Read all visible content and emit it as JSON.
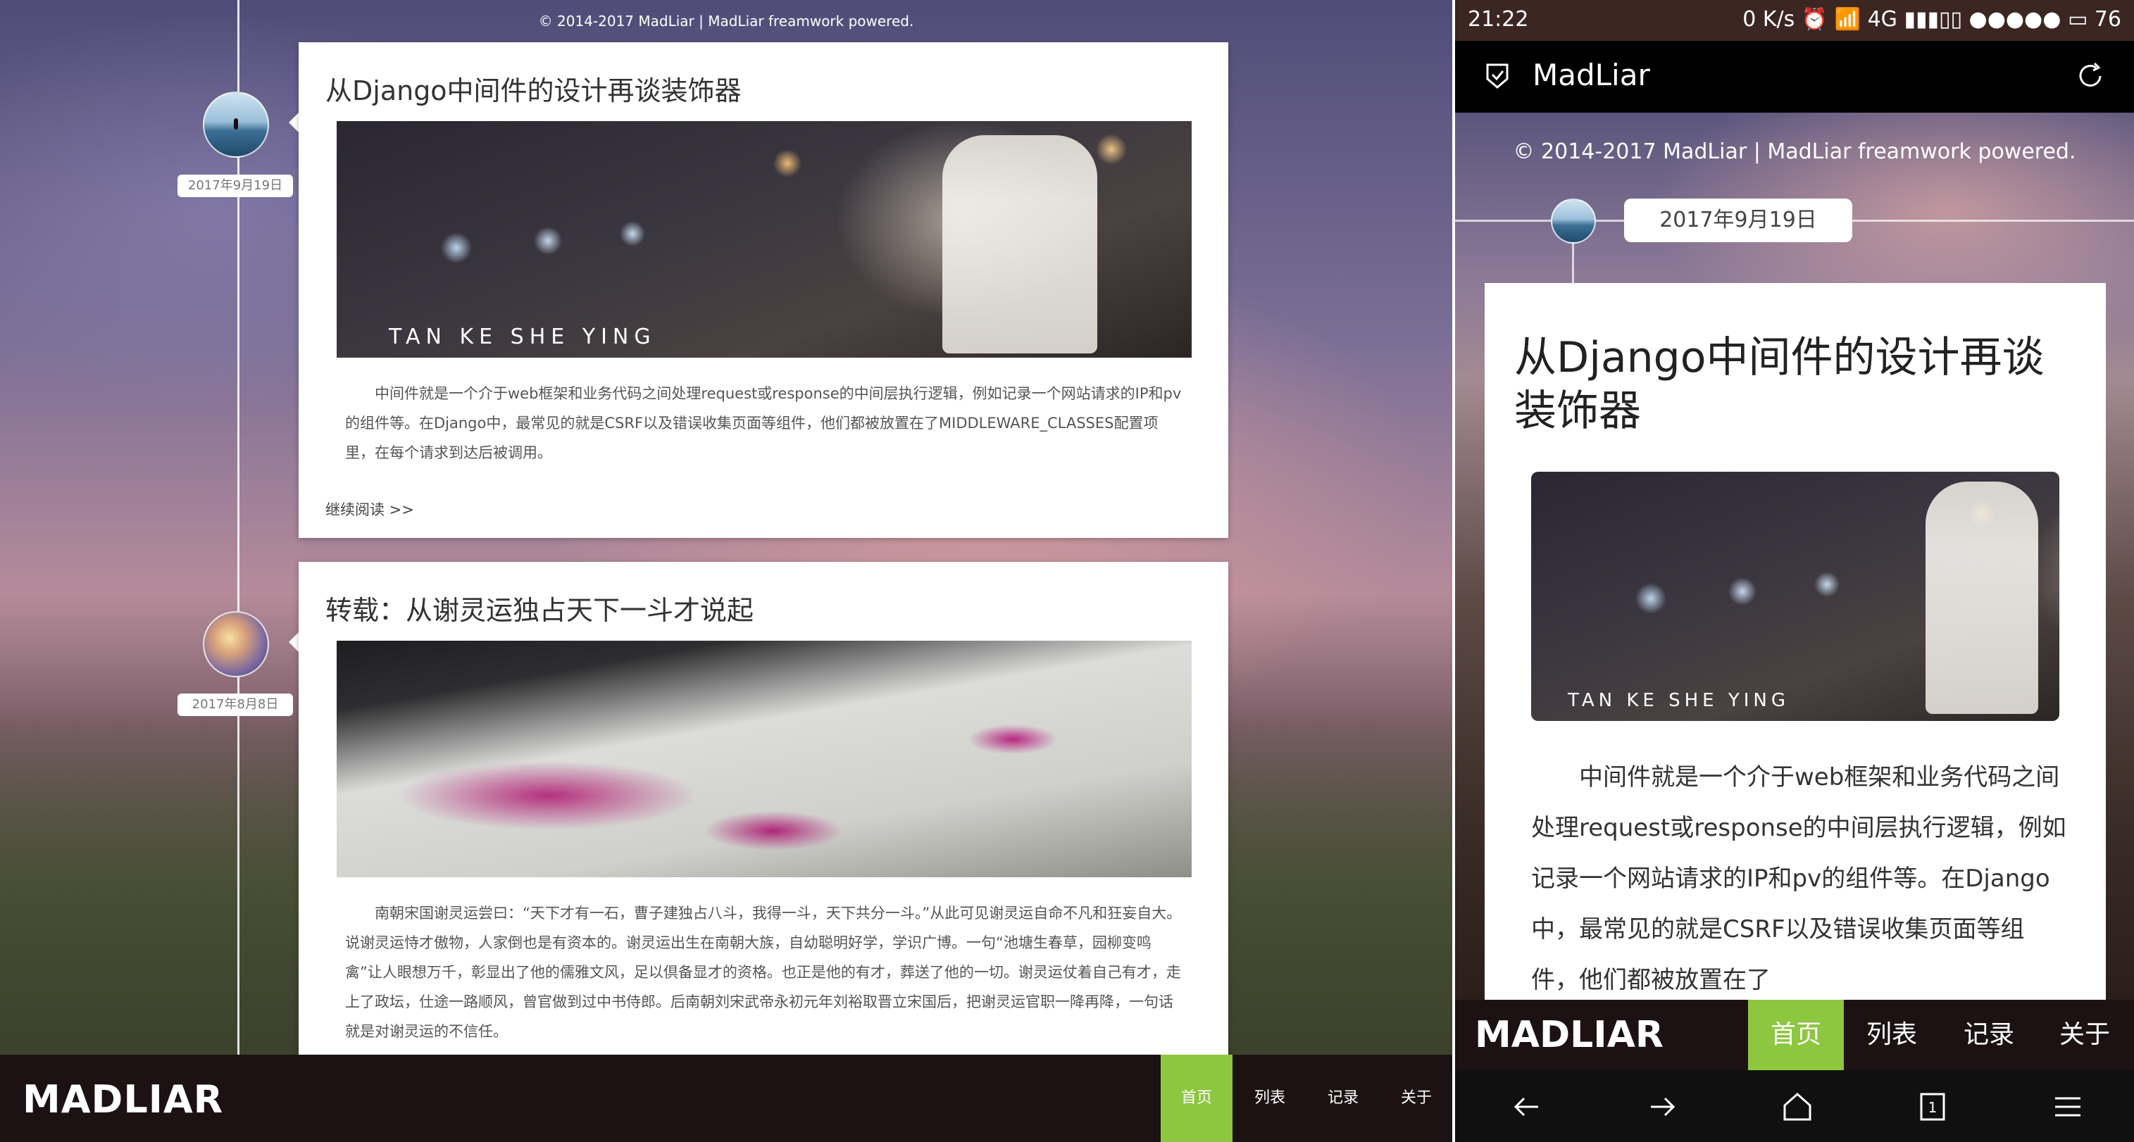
{
  "desktop": {
    "copyright": "© 2014-2017 MadLiar | MadLiar freamwork powered.",
    "logo": "MADLIAR",
    "nav": [
      "首页",
      "列表",
      "记录",
      "关于"
    ],
    "posts": [
      {
        "date": "2017年9月19日",
        "title": "从Django中间件的设计再谈装饰器",
        "cover_caption": "TAN KE SHE YING",
        "excerpt": "中间件就是一个介于web框架和业务代码之间处理request或response的中间层执行逻辑，例如记录一个网站请求的IP和pv的组件等。在Django中，最常见的就是CSRF以及错误收集页面等组件，他们都被放置在了MIDDLEWARE_CLASSES配置项里，在每个请求到达后被调用。",
        "read_more": "继续阅读 >>"
      },
      {
        "date": "2017年8月8日",
        "title": "转载：从谢灵运独占天下一斗才说起",
        "excerpt": "南朝宋国谢灵运尝曰：“天下才有一石，曹子建独占八斗，我得一斗，天下共分一斗。”从此可见谢灵运自命不凡和狂妄自大。说谢灵运恃才傲物，人家倒也是有资本的。谢灵运出生在南朝大族，自幼聪明好学，学识广博。一句“池塘生春草，园柳变鸣禽”让人眼想万千，彰显出了他的儒雅文风，足以倶备显才的资格。也正是他的有才，葬送了他的一切。谢灵运仗着自己有才，走上了政坛，仕途一路顺风，曾官做到过中书侍郎。后南朝刘宋武帝永初元年刘裕取晋立宋国后，把谢灵运官职一降再降，一句话就是对谢灵运的不信任。"
      }
    ]
  },
  "phone": {
    "status": {
      "time": "21:22",
      "right": "0 K/s ⏰ 📶 4G ▮▮▮▯▯ ●●●●● ▭ 76"
    },
    "appbar_title": "MadLiar",
    "copyright": "© 2014-2017 MadLiar | MadLiar freamwork powered.",
    "post": {
      "date": "2017年9月19日",
      "title": "从Django中间件的设计再谈装饰器",
      "cover_caption": "TAN KE SHE YING",
      "excerpt": "中间件就是一个介于web框架和业务代码之间处理request或response的中间层执行逻辑，例如记录一个网站请求的IP和pv的组件等。在Django中，最常见的就是CSRF以及错误收集页面等组件，他们都被放置在了"
    },
    "logo": "MADLIAR",
    "nav": [
      "首页",
      "列表",
      "记录",
      "关于"
    ],
    "accent_color": "#8dc63f"
  }
}
